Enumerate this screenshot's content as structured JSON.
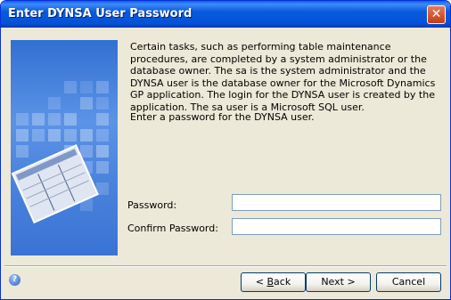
{
  "window": {
    "title": "Enter DYNSA User Password",
    "close_label": "✕"
  },
  "description": "Certain tasks, such as performing table maintenance procedures, are completed by a system administrator or the database owner.  The sa is the system administrator and the DYNSA user is the database owner for the Microsoft Dynamics GP application.  The login for the DYNSA user is created by the application.  The sa user is a Microsoft SQL user.",
  "prompt": "Enter a password for the DYNSA user.",
  "fields": {
    "password_label": "Password:",
    "password_value": "",
    "confirm_label": "Confirm Password:",
    "confirm_value": ""
  },
  "buttons": {
    "back_prefix": "< ",
    "back_mnemonic": "B",
    "back_rest": "ack",
    "next_label": "Next >",
    "cancel_label": "Cancel"
  },
  "help_icon": {
    "glyph": "?",
    "icon": "help-icon"
  },
  "colors": {
    "titlebar": "#0a5ae0",
    "panel": "#ece9d8",
    "art": "#4d86de"
  }
}
